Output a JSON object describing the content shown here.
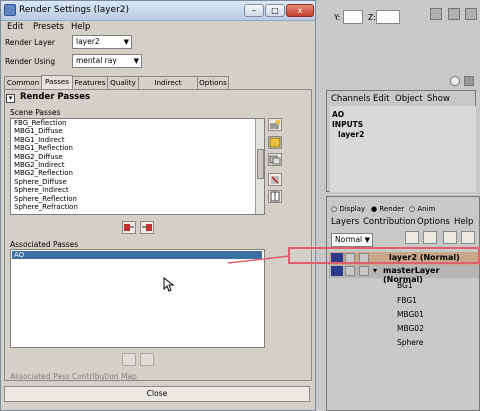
{
  "window": {
    "title": "Render Settings (layer2)",
    "controls": [
      "–",
      "□",
      "x"
    ]
  },
  "menubar": [
    "Edit",
    "Presets",
    "Help"
  ],
  "render_layer": {
    "label": "Render Layer",
    "value": "layer2"
  },
  "render_using": {
    "label": "Render Using",
    "value": "mental ray"
  },
  "tabs": [
    "Common",
    "Passes",
    "Features",
    "Quality",
    "Indirect Lighting",
    "Options"
  ],
  "active_tab": "Passes",
  "section_title": "Render Passes",
  "scene_passes": {
    "label": "Scene Passes",
    "items": [
      "FBG_Reflection",
      "MBG1_Diffuse",
      "MBG1_Indirect",
      "MBG1_Reflection",
      "MBG2_Diffuse",
      "MBG2_Indirect",
      "MBG2_Reflection",
      "Sphere_Diffuse",
      "Sphere_Indirect",
      "Sphere_Reflection",
      "Sphere_Refraction"
    ]
  },
  "associated_passes": {
    "label": "Associated Passes",
    "items": [
      "AO"
    ]
  },
  "contribution_map_label": "Associated Pass Contribution Map",
  "close_label": "Close",
  "top_strip": {
    "y_label": "Y:",
    "z_label": "Z:"
  },
  "channel_box": {
    "menus": [
      "Channels",
      "Edit",
      "Object",
      "Show"
    ],
    "object_name": "AO",
    "inputs_label": "INPUTS",
    "input_item": "layer2"
  },
  "layer_editor": {
    "modes": [
      "Display",
      "Render",
      "Anim"
    ],
    "selected_mode": "Render",
    "menus": [
      "Layers",
      "Contribution",
      "Options",
      "Help"
    ],
    "blend_mode": "Normal",
    "layers": [
      {
        "name": "layer2 (Normal)",
        "highlighted": true
      },
      {
        "name": "masterLayer (Normal)",
        "highlighted": false
      }
    ],
    "sub_items": [
      "BG1",
      "FBG1",
      "MBG01",
      "MBG02",
      "Sphere"
    ]
  },
  "colors": {
    "selection": "#3a6ea5",
    "annotation": "#e06070",
    "layer_highlight": "#c8a888"
  }
}
